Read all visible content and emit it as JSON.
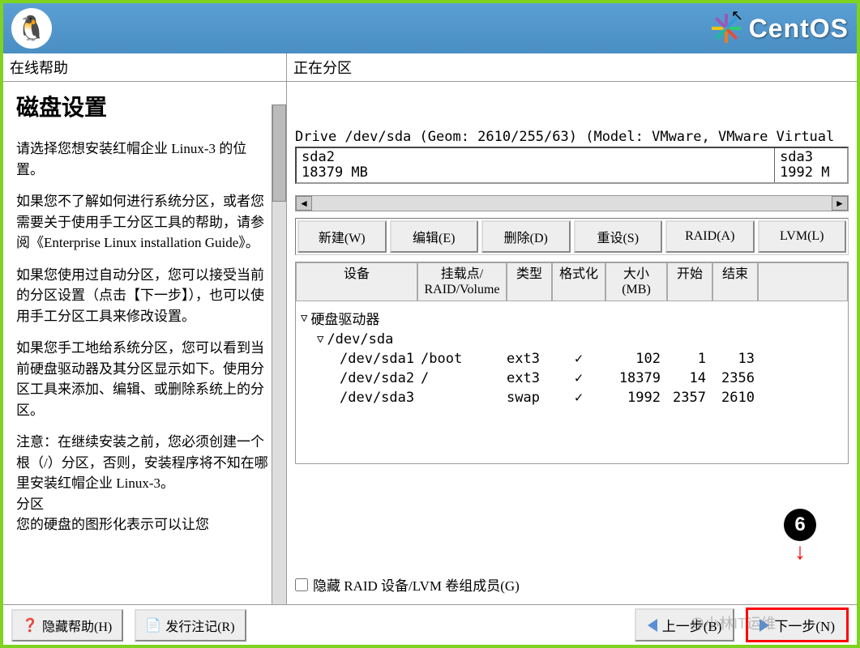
{
  "header": {
    "brand": "CentOS"
  },
  "help": {
    "panel_title": "在线帮助",
    "title": "磁盘设置",
    "paragraphs": [
      "请选择您想安装红帽企业 Linux-3 的位置。",
      "如果您不了解如何进行系统分区，或者您需要关于使用手工分区工具的帮助，请参阅《Enterprise Linux installation Guide》。",
      "如果您使用过自动分区，您可以接受当前的分区设置（点击【下一步】），也可以使用手工分区工具来修改设置。",
      "如果您手工地给系统分区，您可以看到当前硬盘驱动器及其分区显示如下。使用分区工具来添加、编辑、或删除系统上的分区。",
      "注意：在继续安装之前，您必须创建一个根（/）分区，否则，安装程序将不知在哪里安装红帽企业 Linux-3。\n分区\n您的硬盘的图形化表示可以让您"
    ]
  },
  "partition": {
    "panel_title": "正在分区",
    "drive_info": "Drive /dev/sda (Geom: 2610/255/63) (Model: VMware, VMware Virtual",
    "segments": [
      {
        "name": "sda2",
        "size": "18379 MB"
      },
      {
        "name": "sda3",
        "size": "1992 M"
      }
    ],
    "buttons": {
      "new": "新建(W)",
      "edit": "编辑(E)",
      "delete": "删除(D)",
      "reset": "重设(S)",
      "raid": "RAID(A)",
      "lvm": "LVM(L)"
    },
    "columns": {
      "device": "设备",
      "mount": "挂载点/\nRAID/Volume",
      "type": "类型",
      "format": "格式化",
      "size": "大小\n(MB)",
      "start": "开始",
      "end": "结束"
    },
    "tree_root": "硬盘驱动器",
    "tree_drive": "/dev/sda",
    "rows": [
      {
        "device": "/dev/sda1",
        "mount": "/boot",
        "type": "ext3",
        "format": "✓",
        "size": "102",
        "start": "1",
        "end": "13"
      },
      {
        "device": "/dev/sda2",
        "mount": "/",
        "type": "ext3",
        "format": "✓",
        "size": "18379",
        "start": "14",
        "end": "2356"
      },
      {
        "device": "/dev/sda3",
        "mount": "",
        "type": "swap",
        "format": "✓",
        "size": "1992",
        "start": "2357",
        "end": "2610"
      }
    ],
    "hide_raid_label": "隐藏 RAID 设备/LVM 卷组成员(G)"
  },
  "footer": {
    "hide_help": "隐藏帮助(H)",
    "release_notes": "发行注记(R)",
    "back": "上一步(B)",
    "next": "下一步(N)"
  },
  "annotation": {
    "step": "6"
  },
  "watermark": "@小林IT运维"
}
